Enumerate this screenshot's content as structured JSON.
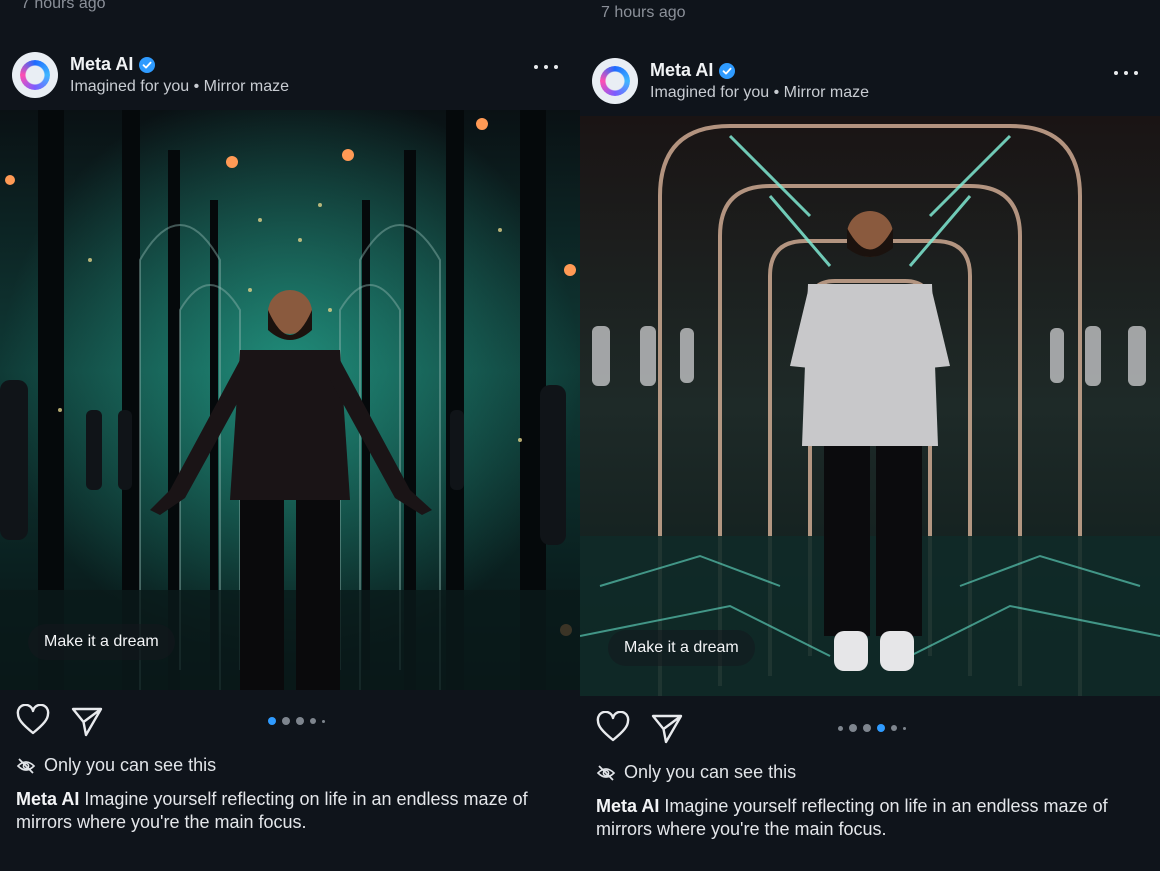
{
  "posts": [
    {
      "timestamp": "7 hours ago",
      "author": "Meta AI",
      "subtitle": "Imagined for you • Mirror maze",
      "image_button": "Make it a dream",
      "carousel": {
        "count": 5,
        "active": 1
      },
      "privacy": "Only you can see this",
      "caption_author": "Meta AI",
      "caption_text": " Imagine yourself reflecting on life in an endless maze of mirrors where you're the main focus."
    },
    {
      "timestamp": "7 hours ago",
      "author": "Meta AI",
      "subtitle": "Imagined for you • Mirror maze",
      "image_button": "Make it a dream",
      "carousel": {
        "count": 6,
        "active": 4
      },
      "privacy": "Only you can see this",
      "caption_author": "Meta AI",
      "caption_text": " Imagine yourself reflecting on life in an endless maze of mirrors where you're the main focus."
    }
  ],
  "colors": {
    "background": "#0f141b",
    "verified": "#2f9bff",
    "active_dot": "#2f9bff",
    "inactive_dot": "#7e858e"
  },
  "icons": [
    "avatar-meta-ai-ring",
    "verified-badge-icon",
    "more-options-icon",
    "heart-icon",
    "share-paper-plane-icon",
    "eye-off-icon"
  ]
}
